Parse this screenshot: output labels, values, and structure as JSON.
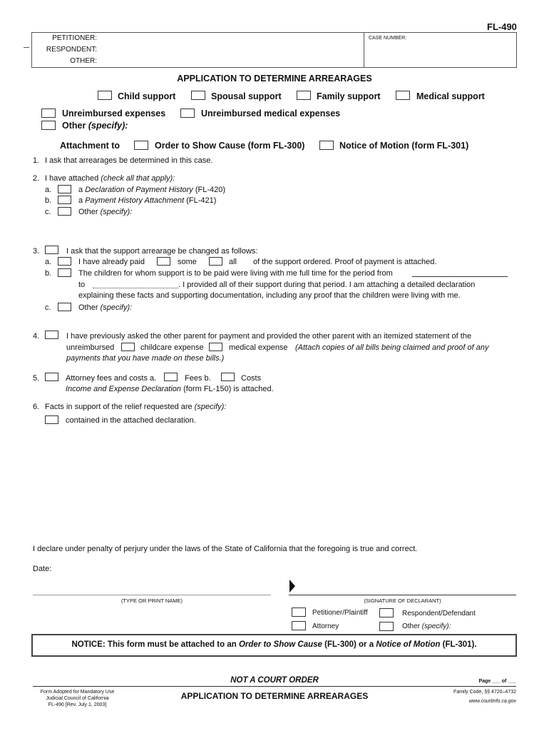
{
  "form_id": "FL-490",
  "caption": {
    "petitioner_label": "PETITIONER:",
    "respondent_label": "RESPONDENT:",
    "other_label": "OTHER:",
    "case_number_label": "CASE NUMBER:"
  },
  "title": "APPLICATION TO DETERMINE ARREARAGES",
  "support_types": {
    "child": "Child support",
    "spousal": "Spousal support",
    "family": "Family support",
    "medical": "Medical support",
    "unreimbursed": "Unreimbursed expenses",
    "unreimbursed_medical": "Unreimbursed medical expenses",
    "other": "Other",
    "other_specify": "(specify):"
  },
  "attachment": {
    "label": "Attachment to",
    "osc": "Order to Show Cause (form FL-300)",
    "notice": "Notice of Motion (form FL-301)"
  },
  "items": {
    "i1": {
      "num": "1.",
      "text": "I ask that arrearages be determined in this case."
    },
    "i2": {
      "num": "2.",
      "text": "I have attached",
      "note": "(check all that apply):",
      "a_letter": "a.",
      "a_pre": "a",
      "a_ital": "Declaration of Payment History",
      "a_post": "(FL-420)",
      "b_letter": "b.",
      "b_pre": "a",
      "b_ital": "Payment History Attachment",
      "b_post": "(FL-421)",
      "c_letter": "c.",
      "c_text": "Other",
      "c_ital": "(specify):"
    },
    "i3": {
      "num": "3.",
      "text": "I ask that the support arrearage be changed as follows:",
      "a_letter": "a.",
      "a_text": "I have already paid",
      "a_some": "some",
      "a_all": "all",
      "a_post": "of the support ordered. Proof of payment is attached.",
      "b_letter": "b.",
      "b_text": "The children for whom support is to be paid were living with me full time for the period from",
      "b_to": "to",
      "b_line2": ". I provided all of their support during that period. I am attaching a detailed declaration",
      "b_line3": "explaining these facts and supporting documentation, including any proof that the children were living with me.",
      "c_letter": "c.",
      "c_text": "Other",
      "c_ital": "(specify):"
    },
    "i4": {
      "num": "4.",
      "text": "I have previously asked the other parent for payment and provided the other parent with an itemized statement of the",
      "unreimbursed": "unreimbursed",
      "childcare": "childcare expense",
      "medical": "medical expense",
      "note1": "(Attach copies of all bills being claimed and proof of any",
      "note2": "payments that you have made on these bills.)"
    },
    "i5": {
      "num": "5.",
      "text": "Attorney fees and costs a.",
      "fees": "Fees  b.",
      "costs": "Costs",
      "line2_ital": "Income and Expense Declaration",
      "line2_post": "(form FL-150) is attached."
    },
    "i6": {
      "num": "6.",
      "text": "Facts in support of the relief requested are",
      "ital": "(specify):",
      "contained": "contained in the attached declaration."
    }
  },
  "declaration": "I declare under penalty of perjury under the laws of the State of California that the foregoing is true and correct.",
  "date_label": "Date:",
  "print_name_label": "(TYPE OR PRINT NAME)",
  "signature_label": "(SIGNATURE OF DECLARANT)",
  "roles": {
    "petitioner": "Petitioner/Plaintiff",
    "respondent": "Respondent/Defendant",
    "attorney": "Attorney",
    "other": "Other",
    "other_specify": "(specify):"
  },
  "notice": {
    "prefix": "NOTICE:  This form must be attached to an",
    "osc_ital": "Order to Show Cause",
    "mid": "(FL-300) or a",
    "nom_ital": "Notice of Motion",
    "post": "(FL-301)."
  },
  "footer": {
    "not_order": "NOT A COURT ORDER",
    "page": "Page ___ of ___",
    "adopted1": "Form Adopted for Mandatory Use",
    "adopted2": "Judicial Council of California",
    "adopted3": "FL-490 [Rev. July 1, 2003]",
    "title": "APPLICATION TO DETERMINE ARREARAGES",
    "code": "Family Code, §§ 4720–4732",
    "url": "www.courtinfo.ca.gov"
  }
}
